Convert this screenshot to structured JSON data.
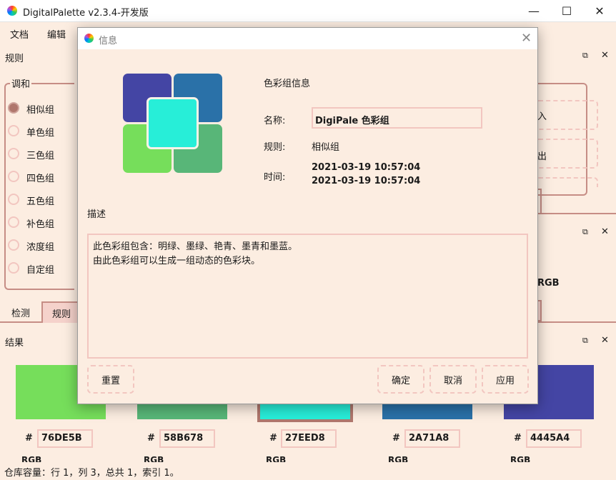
{
  "app": {
    "title": "DigitalPalette v2.3.4-开发版",
    "window_controls": {
      "minimize": "—",
      "maximize": "☐",
      "close": "✕"
    }
  },
  "menu": {
    "items": [
      "文档",
      "编辑"
    ]
  },
  "rule_panel": {
    "title": "规则",
    "group_label": "调和",
    "options": [
      {
        "label": "相似组",
        "checked": true
      },
      {
        "label": "单色组",
        "checked": false
      },
      {
        "label": "三色组",
        "checked": false
      },
      {
        "label": "四色组",
        "checked": false
      },
      {
        "label": "五色组",
        "checked": false
      },
      {
        "label": "补色组",
        "checked": false
      },
      {
        "label": "浓度组",
        "checked": false
      },
      {
        "label": "自定组",
        "checked": false
      }
    ],
    "right_buttons": [
      "入",
      "出"
    ]
  },
  "right_panel": {
    "partial_label": "RGB"
  },
  "tabs": [
    {
      "label": "检测",
      "active": false
    },
    {
      "label": "规则",
      "active": true
    }
  ],
  "result_panel": {
    "title": "结果",
    "swatches": [
      {
        "color": "#76DE5B",
        "hex": "76DE5B",
        "selected": false
      },
      {
        "color": "#58B678",
        "hex": "58B678",
        "selected": false
      },
      {
        "color": "#27EED8",
        "hex": "27EED8",
        "selected": true
      },
      {
        "color": "#2A71A8",
        "hex": "2A71A8",
        "selected": false
      },
      {
        "color": "#4445A4",
        "hex": "4445A4",
        "selected": false
      }
    ],
    "rgb_label": "RGB"
  },
  "status": {
    "text": "仓库容量：行 1，列 3，总共 1，索引 1。"
  },
  "dialog": {
    "title": "信息",
    "section_title": "色彩组信息",
    "name_label": "名称:",
    "name_value": "DigiPale 色彩组",
    "rule_label": "规则:",
    "rule_value": "相似组",
    "time_label": "时间:",
    "time_created": "2021-03-19 10:57:04",
    "time_modified": "2021-03-19 10:57:04",
    "desc_label": "描述",
    "desc_line1": "此色彩组包含：明绿、墨绿、艳青、墨青和墨蓝。",
    "desc_line2": "由此色彩组可以生成一组动态的色彩块。",
    "buttons": {
      "reset": "重置",
      "ok": "确定",
      "cancel": "取消",
      "apply": "应用"
    },
    "tile_colors": {
      "top_left": "#4445A4",
      "top_right": "#2A71A8",
      "bottom_left": "#76DE5B",
      "bottom_right": "#58B678",
      "center": "#27EED8"
    }
  }
}
